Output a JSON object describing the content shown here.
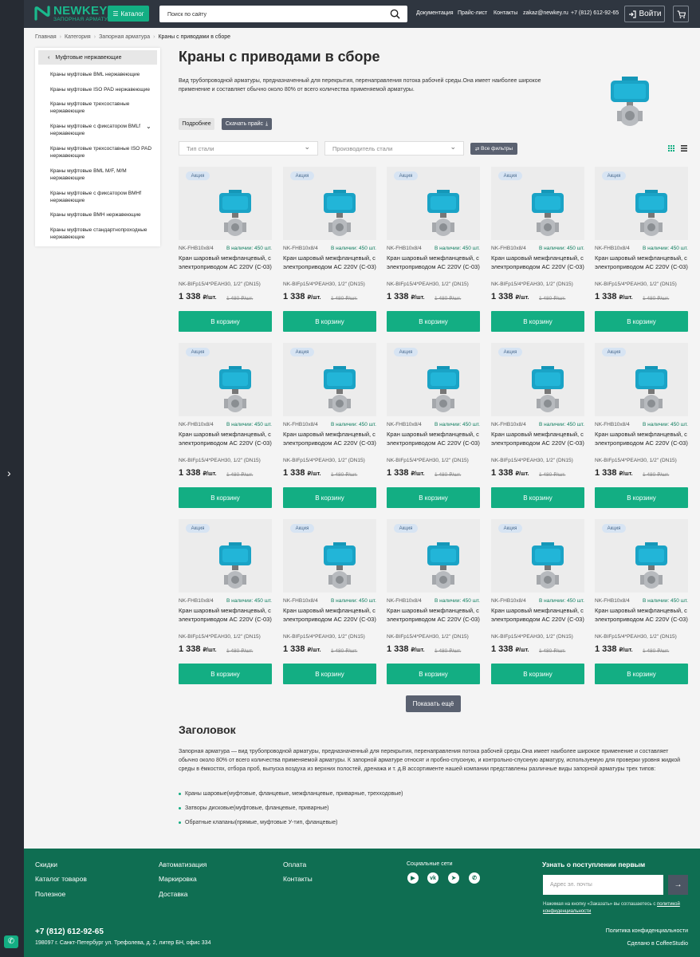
{
  "header": {
    "logo_main": "NEWKEY",
    "logo_sub": "ЗАПОРНАЯ АРМАТУРА",
    "catalog_label": "Каталог",
    "search_placeholder": "Поиск по сайту",
    "nav": [
      "Документация",
      "Прайс-лист",
      "Контакты"
    ],
    "email": "zakaz@newkey.ru",
    "phone": "+7 (812) 612-92-65",
    "login_label": "Войти",
    "accent_color": "#13ae83",
    "header_bg": "#2f3640"
  },
  "breadcrumbs": [
    "Главная",
    "Категория",
    "Запорная арматура",
    "Краны с приводами в сборе"
  ],
  "sidebar": {
    "current": "Муфтовые нержавеющие",
    "items": [
      "Краны муфтовые BML нержавеющие",
      "Краны муфтовые ISO PAD нержавеющие",
      "Краны муфтовые трехсоставные нержавеющие",
      "Краны муфтовые с фиксатором BMLf нержавеющие",
      "Краны муфтовые трехсоставные ISO PAD нержавеющие",
      "Краны муфтовые BML M/F, M/M нержавеющие",
      "Краны муфтовые с фиксатором BMHf нержавеющие",
      "Краны муфтовые BMH нержавеющие",
      "Краны муфтовые стандартнопроходные нержавеющие"
    ]
  },
  "page": {
    "title": "Краны с приводами в сборе",
    "intro": "Вид трубопроводной арматуры, предназначенный для перекрытия, перенаправления потока рабочей среды.Она имеет наиболее широкое применение и составляет обычно около 80% от всего количества применяемой арматуры.",
    "more_btn": "Подробнее",
    "price_btn": "Скачать прайс",
    "filter_steel": "Тип стали",
    "filter_maker": "Производитель стали",
    "all_filters": "Все фильтры"
  },
  "product": {
    "badge": "Акция",
    "sku": "NK-FHB10x8/4",
    "stock": "В наличии: 450 шт.",
    "name": "Кран шаровый межфланцевый, с электроприводом AC 220V (C-03)",
    "code": "NK-BIFp15/4*PEAH30, 1/2\" (DN15)",
    "price": "1 338",
    "price_unit": "₽/шт.",
    "old_price": "1 480 ₽/шт.",
    "buy_label": "В корзину"
  },
  "show_more": "Показать ещё",
  "seo": {
    "title": "Заголовок",
    "text": "Запорная арматура — вид трубопроводной арматуры, предназначенный для перекрытия, перенаправления потока рабочей среды.Она имеет наиболее широкое применение и составляет обычно около 80% от всего количества применяемой арматуры. К запорной арматуре относят и пробно-спускную, и контрольно-спускную арматуру, используемую для проверки уровня жидкой среды в ёмкостях, отбора проб, выпуска воздуха из верхних полостей, дренажа и т. д.В ассортименте нашей компании представлены различные виды запорной арматуры трех типов:",
    "bullets": [
      "Краны шаровые(муфтовые, фланцевые, межфланцевые, приварные, трехходовые)",
      "Затворы дисковые(муфтовые, фланцевые, приварные)",
      "Обратные клапаны(прямые, муфтовые У-тип, фланцевые)"
    ]
  },
  "footer": {
    "col1": [
      "Скидки",
      "Каталог товаров",
      "Полезное"
    ],
    "col2": [
      "Автоматизация",
      "Маркировка",
      "Доставка"
    ],
    "col3": [
      "Оплата",
      "Контакты"
    ],
    "social_title": "Социальные сети",
    "news_title": "Узнать о поступлении первым",
    "news_placeholder": "Адрес эл. почты",
    "news_note": "Нажимая на кнопку «Заказать» вы соглашаетесь с",
    "news_link": "политикой конфиденциальности",
    "phone": "+7 (812) 612-92-65",
    "address": "198097 г. Санкт-Петербург ул. Трефолева, д. 2, литер БН, офис 334",
    "privacy": "Политика конфиденциальности",
    "made_by": "Сделано в CoffeeStudio",
    "bg_color": "#0f6e52"
  }
}
